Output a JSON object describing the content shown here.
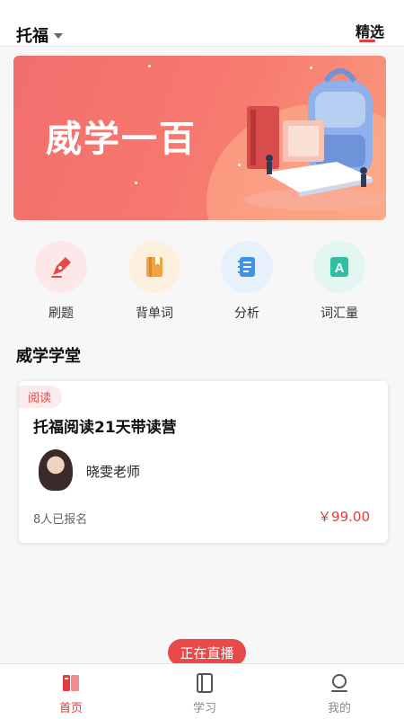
{
  "header": {
    "exam": "托福",
    "featured_tab": "精选"
  },
  "banner": {
    "title": "威学一百"
  },
  "quick_links": [
    {
      "label": "刷题",
      "icon": "pen-icon",
      "color": "#fce8e8",
      "accent": "#e24b4b"
    },
    {
      "label": "背单词",
      "icon": "book-icon",
      "color": "#fdf0df",
      "accent": "#f0a341"
    },
    {
      "label": "分析",
      "icon": "notebook-icon",
      "color": "#e6f1fb",
      "accent": "#3f93e6"
    },
    {
      "label": "词汇量",
      "icon": "letter-a-icon",
      "color": "#e3f6f2",
      "accent": "#2fbfa2"
    }
  ],
  "section": {
    "title": "威学学堂"
  },
  "course": {
    "tag": "阅读",
    "title": "托福阅读21天带读营",
    "teacher": "晓雯老师",
    "enrolled": "8人已报名",
    "price": "￥99.00"
  },
  "live_badge": "正在直播",
  "nav": [
    {
      "label": "首页",
      "icon": "home-icon",
      "active": true
    },
    {
      "label": "学习",
      "icon": "study-icon",
      "active": false
    },
    {
      "label": "我的",
      "icon": "profile-icon",
      "active": false
    }
  ]
}
